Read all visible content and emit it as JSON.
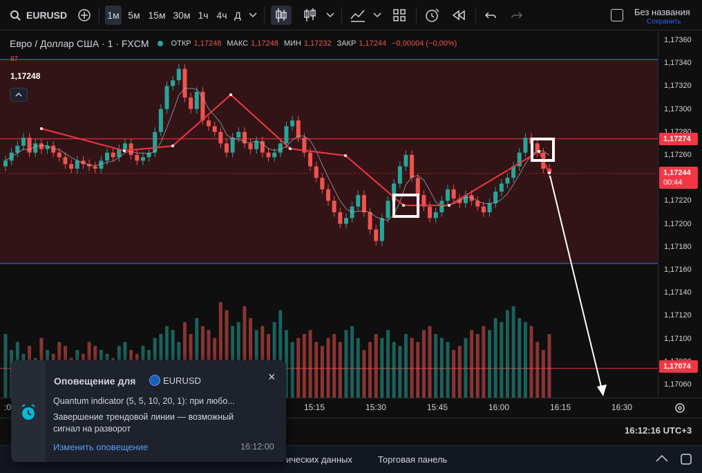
{
  "toolbar": {
    "symbol": "EURUSD",
    "intervals": [
      "1м",
      "5м",
      "15м",
      "30м",
      "1ч",
      "4ч",
      "Д"
    ],
    "active_interval": "1м",
    "layout_title": "Без названия",
    "layout_save": "Сохранить"
  },
  "legend": {
    "instrument": "Евро / Доллар США · 1 · FXCM",
    "open_label": "ОТКР",
    "open": "1,17248",
    "high_label": "МАКС",
    "high": "1,17248",
    "low_label": "МИН",
    "low": "1,17232",
    "close_label": "ЗАКР",
    "close": "1,17244",
    "change": "−0,00004 (−0,00%)",
    "indicator_value": "87",
    "crosshair_price": "1,17248"
  },
  "price_axis": {
    "labels": [
      "1,17360",
      "1,17340",
      "1,17320",
      "1,17300",
      "1,17280",
      "1,17260",
      "1,17240",
      "1,17220",
      "1,17200",
      "1,17180",
      "1,17160",
      "1,17140",
      "1,17120",
      "1,17100",
      "1,17080",
      "1,17060"
    ],
    "tag_upper": "1,17274",
    "tag_current": "1,17244",
    "tag_countdown": "00:44",
    "tag_lower": "1,17074"
  },
  "time_axis": {
    "labels": [
      "15:15",
      "15:30",
      "15:45",
      "16:00",
      "16:15",
      "16:30"
    ],
    "left_fragment": ":0"
  },
  "status": {
    "clock": "16:12:16 UTC+3"
  },
  "bottom_tabs": {
    "fragment": "ических данных",
    "trading_panel": "Торговая панель"
  },
  "alert": {
    "title": "Оповещение для",
    "symbol": "EURUSD",
    "line1": "Quantum indicator (5, 5, 10, 20, 1): при любо...",
    "line2": "Завершение трендовой линии — возможный",
    "line3": "сигнал на разворот",
    "edit_link": "Изменить оповещение",
    "time": "16:12:00"
  },
  "colors": {
    "up": "#26a69a",
    "down": "#ef5350",
    "zone": "#3a1518",
    "blue_line": "#2962ff",
    "trend": "#f23645"
  },
  "chart_data": {
    "type": "candlestick",
    "ylim": [
      1.1705,
      1.1737
    ],
    "candles_close": [
      1.17255,
      1.17262,
      1.17268,
      1.17275,
      1.17262,
      1.1727,
      1.17265,
      1.17268,
      1.17262,
      1.17258,
      1.17252,
      1.17248,
      1.17255,
      1.17252,
      1.1725,
      1.17248,
      1.17255,
      1.17262,
      1.17258,
      1.17265,
      1.1727,
      1.1726,
      1.17255,
      1.17258,
      1.17262,
      1.1728,
      1.173,
      1.1732,
      1.17325,
      1.17335,
      1.1731,
      1.173,
      1.17315,
      1.1729,
      1.17285,
      1.1728,
      1.1727,
      1.17262,
      1.17275,
      1.1728,
      1.1727,
      1.17265,
      1.17272,
      1.17262,
      1.17258,
      1.17262,
      1.1727,
      1.17285,
      1.1729,
      1.17275,
      1.17262,
      1.1725,
      1.1724,
      1.1723,
      1.1722,
      1.1721,
      1.172,
      1.17205,
      1.17215,
      1.17225,
      1.1721,
      1.17195,
      1.17185,
      1.17205,
      1.1722,
      1.17235,
      1.1725,
      1.1726,
      1.1724,
      1.17225,
      1.17215,
      1.17205,
      1.1721,
      1.1722,
      1.1723,
      1.17222,
      1.17218,
      1.17225,
      1.1722,
      1.17215,
      1.1721,
      1.17218,
      1.17228,
      1.17235,
      1.1724,
      1.1725,
      1.17262,
      1.17275,
      1.1727,
      1.17262,
      1.17248,
      1.17244
    ],
    "volumes": [
      80,
      60,
      70,
      55,
      65,
      50,
      75,
      60,
      55,
      70,
      65,
      50,
      60,
      55,
      70,
      65,
      60,
      55,
      50,
      65,
      70,
      60,
      55,
      65,
      60,
      75,
      80,
      90,
      85,
      70,
      95,
      80,
      100,
      90,
      85,
      75,
      120,
      110,
      90,
      95,
      115,
      100,
      85,
      90,
      80,
      95,
      110,
      85,
      70,
      75,
      80,
      85,
      70,
      65,
      75,
      80,
      70,
      85,
      90,
      75,
      60,
      70,
      80,
      75,
      85,
      70,
      65,
      80,
      75,
      70,
      85,
      90,
      80,
      75,
      70,
      60,
      65,
      75,
      85,
      80,
      90,
      85,
      100,
      95,
      110,
      115,
      100,
      95,
      90,
      70,
      60
    ],
    "levels": [
      1.17274,
      1.17244,
      1.17074
    ]
  }
}
